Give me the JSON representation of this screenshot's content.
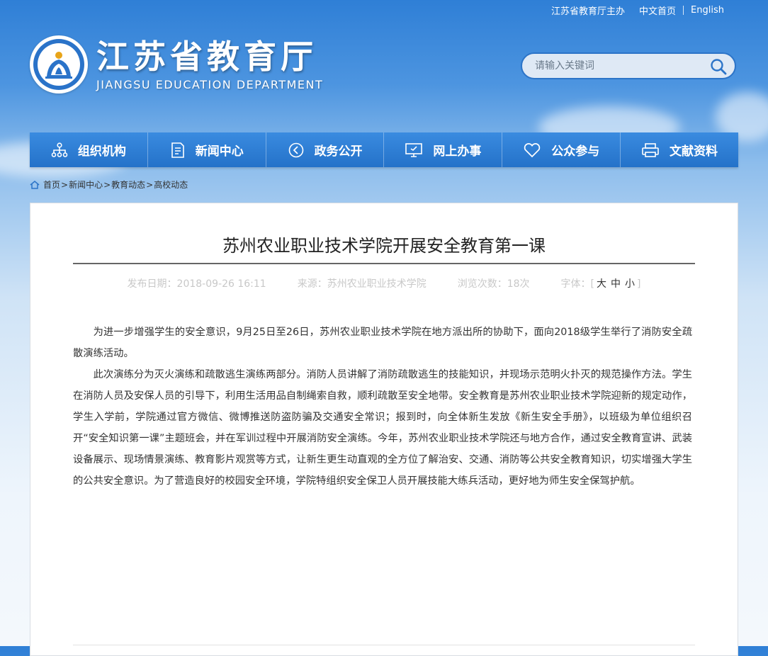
{
  "topbar": {
    "sponsor": "江苏省教育厅主办",
    "home_cn": "中文首页",
    "english": "English"
  },
  "logo": {
    "title_cn": "江苏省教育厅",
    "title_en": "JIANGSU EDUCATION DEPARTMENT"
  },
  "search": {
    "placeholder": "请输入关键词"
  },
  "nav": [
    {
      "label": "组织机构",
      "icon": "org-chart-icon"
    },
    {
      "label": "新闻中心",
      "icon": "document-icon"
    },
    {
      "label": "政务公开",
      "icon": "play-circle-icon"
    },
    {
      "label": "网上办事",
      "icon": "monitor-icon"
    },
    {
      "label": "公众参与",
      "icon": "heart-icon"
    },
    {
      "label": "文献资料",
      "icon": "printer-icon"
    }
  ],
  "breadcrumb": {
    "home": "首页",
    "items": [
      "新闻中心",
      "教育动态",
      "高校动态"
    ],
    "separator": ">"
  },
  "article": {
    "title": "苏州农业职业技术学院开展安全教育第一课",
    "date": "发布日期：2018-09-26 16:11",
    "source": "来源：苏州农业职业技术学院",
    "views": "浏览次数：18次",
    "font_label": "字体：",
    "font_large": "大",
    "font_medium": "中",
    "font_small": "小",
    "bracket_open": "[",
    "bracket_close": "]",
    "paragraphs": [
      "为进一步增强学生的安全意识，9月25日至26日，苏州农业职业技术学院在地方派出所的协助下，面向2018级学生举行了消防安全疏散演练活动。",
      "此次演练分为灭火演练和疏散逃生演练两部分。消防人员讲解了消防疏散逃生的技能知识，并现场示范明火扑灭的规范操作方法。学生在消防人员及安保人员的引导下，利用生活用品自制绳索自救，顺利疏散至安全地带。安全教育是苏州农业职业技术学院迎新的规定动作，学生入学前，学院通过官方微信、微博推送防盗防骗及交通安全常识；报到时，向全体新生发放《新生安全手册》，以班级为单位组织召开“安全知识第一课”主题班会，并在军训过程中开展消防安全演练。今年，苏州农业职业技术学院还与地方合作，通过安全教育宣讲、武装设备展示、现场情景演练、教育影片观赏等方式，让新生更生动直观的全方位了解治安、交通、消防等公共安全教育知识，切实增强大学生的公共安全意识。为了营造良好的校园安全环境，学院特组织安全保卫人员开展技能大练兵活动，更好地为师生安全保驾护航。"
    ]
  },
  "colors": {
    "nav_blue": "#2e7fd6",
    "search_border": "#2c74c8",
    "meta_gray": "#c8c8c8"
  }
}
